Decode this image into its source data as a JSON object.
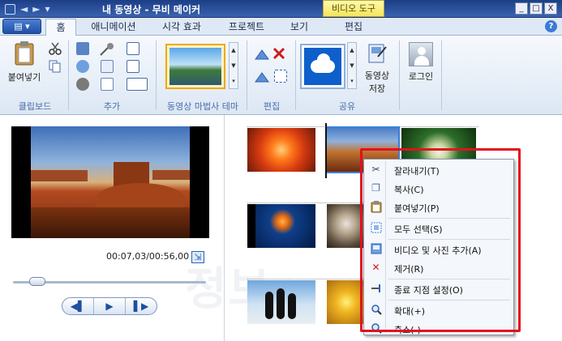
{
  "window": {
    "title": "내 동영상 - 무비 메이커",
    "context_tab": "비디오 도구",
    "qat_glyphs": [
      "◄",
      "►",
      "▾"
    ],
    "win_buttons": [
      "_",
      "□",
      "X"
    ]
  },
  "ribbon_tabs": [
    "홈",
    "애니메이션",
    "시각 효과",
    "프로젝트",
    "보기",
    "편집"
  ],
  "ribbon": {
    "paste_label": "붙여넣기",
    "groups": {
      "clipboard": "클립보드",
      "add": "추가",
      "automovie": "동영상 마법사 테마",
      "edit": "편집",
      "share": "공유"
    },
    "save_movie_line1": "동영상",
    "save_movie_line2": "저장",
    "signin": "로그인",
    "gallery_arrows": [
      "▲",
      "▼",
      "▾"
    ]
  },
  "player": {
    "timecode": "00:07,03/00:56,00",
    "seek_fraction": 0.125,
    "controls": [
      "◀▌",
      "▶",
      "▌▶"
    ],
    "fullscreen_glyph": "⇲"
  },
  "watermark": "정보",
  "context_menu": {
    "items": [
      {
        "label": "잘라내기(T)",
        "icon": "scissors-icon",
        "glyph": "✂",
        "color": "#3a4a6a"
      },
      {
        "label": "복사(C)",
        "icon": "copy-icon",
        "glyph": "❐",
        "color": "#4a6ca8"
      },
      {
        "label": "붙여넣기(P)",
        "icon": "paste-icon",
        "glyph": "📋",
        "color": "#a27a2c"
      },
      {
        "label": "모두 선택(S)",
        "icon": "select-all-icon",
        "glyph": "⬚",
        "color": "#3c7fd8"
      },
      {
        "label": "비디오 및 사진 추가(A)",
        "icon": "add-media-icon",
        "glyph": "▤",
        "color": "#2c62b8"
      },
      {
        "label": "제거(R)",
        "icon": "remove-icon",
        "glyph": "✕",
        "color": "#d11a1a"
      },
      {
        "label": "종료 지점 설정(O)",
        "icon": "set-end-point-icon",
        "glyph": "⊣",
        "color": "#555"
      },
      {
        "label": "확대(+)",
        "icon": "zoom-in-icon",
        "glyph": "🔍",
        "color": "#2c62b8"
      },
      {
        "label": "축소(-)",
        "icon": "zoom-out-icon",
        "glyph": "🔍",
        "color": "#2c62b8"
      }
    ]
  },
  "colors": {
    "highlight_box": "#e3101f",
    "ribbon_accent": "#4a6ca8",
    "context_tab": "#f3e45c"
  }
}
